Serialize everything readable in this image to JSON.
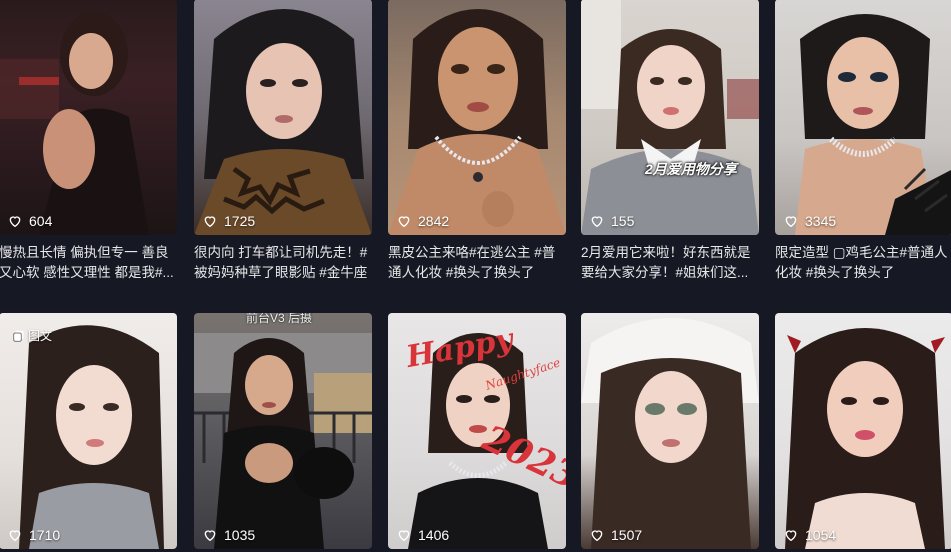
{
  "icons": {
    "like": "heart-outline-icon",
    "tuwen": "image-text-icon"
  },
  "row1": [
    {
      "likes": "604",
      "caption": "慢热且长情 偏执但专一 善良又心软 感性又理性 都是我#..."
    },
    {
      "likes": "1725",
      "caption": "很内向 打车都让司机先走！#被妈妈种草了眼影贴 #金牛座"
    },
    {
      "likes": "2842",
      "caption": "黑皮公主来咯#在逃公主 #普通人化妆 #换头了换头了"
    },
    {
      "likes": "155",
      "caption": "2月爱用它来啦！好东西就是要给大家分享！#姐妹们这...",
      "overlay": "2月爱用物分享"
    },
    {
      "likes": "3345",
      "caption": "限定造型 ▢鸡毛公主#普通人化妆 #换头了换头了"
    }
  ],
  "row2": [
    {
      "likes": "1710",
      "tag": "图文"
    },
    {
      "likes": "1035",
      "overlay_top": "前台V3 后摄"
    },
    {
      "likes": "1406",
      "happy": "Happy",
      "script": "Naughtyface",
      "year": "2023."
    },
    {
      "likes": "1507"
    },
    {
      "likes": "1054"
    }
  ]
}
